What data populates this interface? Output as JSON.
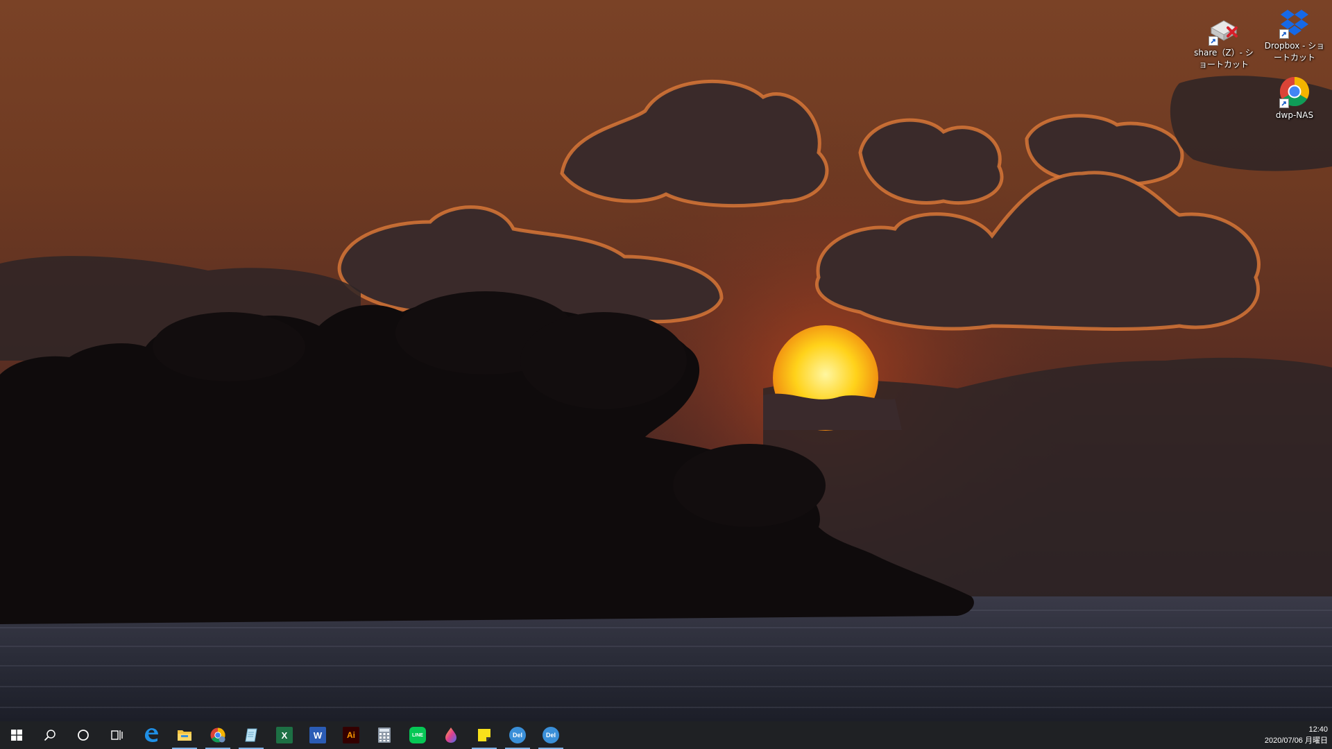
{
  "desktop": {
    "icons": [
      {
        "label": "share（Z）- ショートカット",
        "icon": "network-drive-disconnected-icon"
      },
      {
        "label": "Dropbox - ショートカット",
        "icon": "dropbox-icon"
      },
      {
        "label": "dwp-NAS",
        "icon": "chrome-icon"
      }
    ]
  },
  "taskbar": {
    "start": {
      "icon": "windows-logo-icon"
    },
    "search": {
      "icon": "search-icon"
    },
    "cortana": {
      "icon": "cortana-circle-icon"
    },
    "task_view": {
      "icon": "task-view-icon"
    },
    "apps": [
      {
        "name": "Microsoft Edge",
        "icon": "edge-icon",
        "running": false
      },
      {
        "name": "File Explorer",
        "icon": "folder-icon",
        "running": true
      },
      {
        "name": "Google Chrome",
        "icon": "chrome-icon",
        "running": true
      },
      {
        "name": "Notepad",
        "icon": "notepad-icon",
        "running": true
      },
      {
        "name": "Excel",
        "icon": "excel-icon",
        "text": "X",
        "running": false
      },
      {
        "name": "Word",
        "icon": "word-icon",
        "text": "W",
        "running": false
      },
      {
        "name": "Illustrator",
        "icon": "illustrator-icon",
        "text": "Ai",
        "running": false
      },
      {
        "name": "Calculator",
        "icon": "calculator-icon",
        "running": false
      },
      {
        "name": "LINE",
        "icon": "line-icon",
        "text": "LINE",
        "running": false
      },
      {
        "name": "Paint",
        "icon": "paint-drop-icon",
        "running": false
      },
      {
        "name": "Sticky Notes",
        "icon": "sticky-notes-icon",
        "running": true
      },
      {
        "name": "DeepL",
        "icon": "deepl-icon",
        "text": "Del",
        "running": true
      },
      {
        "name": "DeepL",
        "icon": "deepl-icon",
        "text": "Del",
        "running": true
      }
    ],
    "clock": {
      "time": "12:40",
      "date": "2020/07/06 月曜日"
    }
  },
  "colors": {
    "taskbar_bg": "#1f2124",
    "running_indicator": "#7fb2e6",
    "sky_top": "#7a4226",
    "sun": "#ffd21a"
  }
}
